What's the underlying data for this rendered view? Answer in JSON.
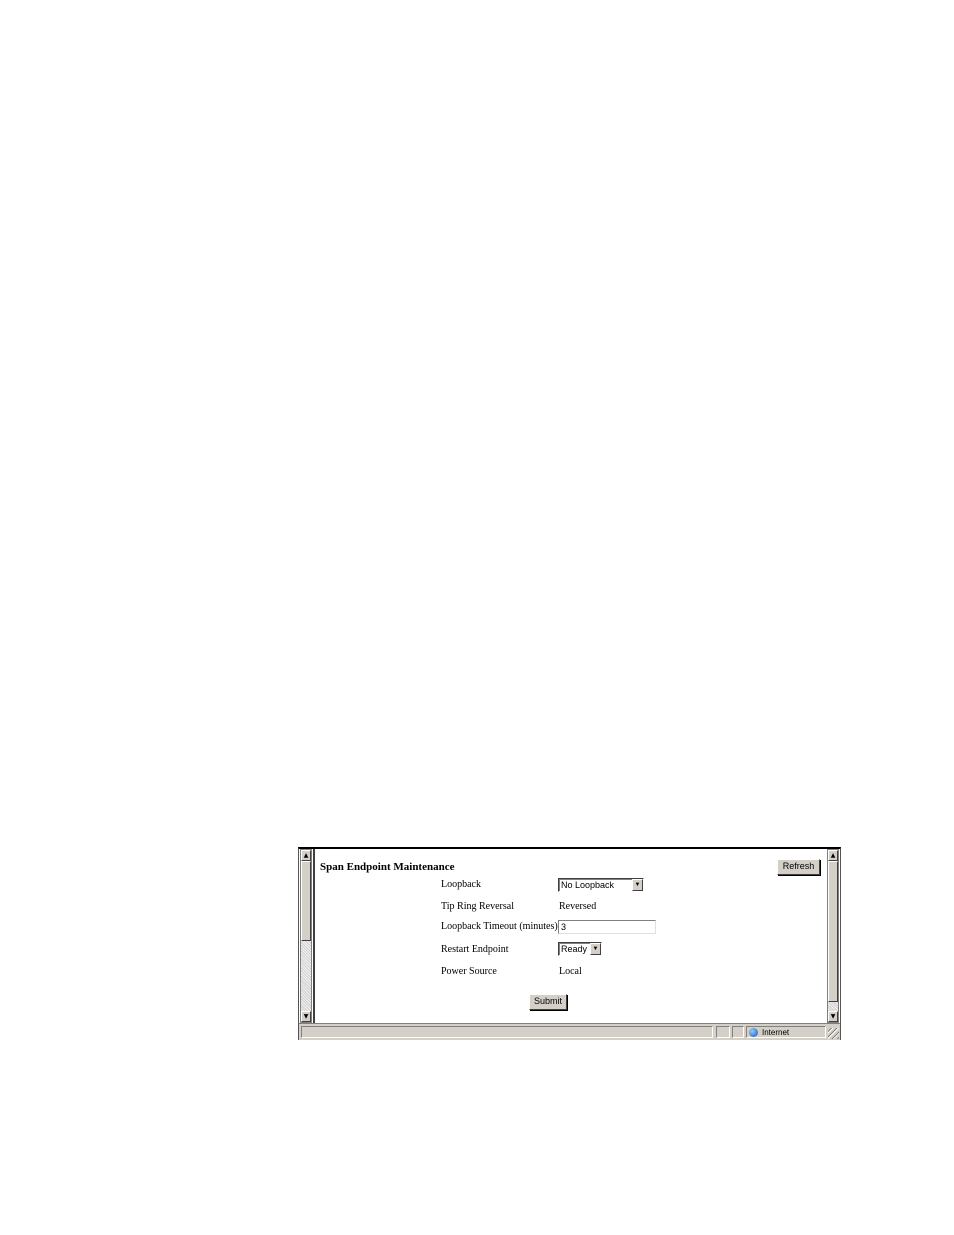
{
  "page": {
    "title": "Span Endpoint Maintenance",
    "refresh_label": "Refresh",
    "submit_label": "Submit"
  },
  "form": {
    "loopback": {
      "label": "Loopback",
      "value": "No Loopback"
    },
    "tip_ring_reversal": {
      "label": "Tip Ring Reversal",
      "value": "Reversed"
    },
    "loopback_timeout": {
      "label": "Loopback Timeout (minutes)",
      "value": "3"
    },
    "restart_endpoint": {
      "label": "Restart Endpoint",
      "value": "Ready"
    },
    "power_source": {
      "label": "Power Source",
      "value": "Local"
    }
  },
  "statusbar": {
    "zone": "Internet"
  },
  "icons": {
    "scroll_up": "triangle-up",
    "scroll_down": "triangle-down",
    "dropdown": "triangle-down",
    "zone": "globe-icon"
  }
}
